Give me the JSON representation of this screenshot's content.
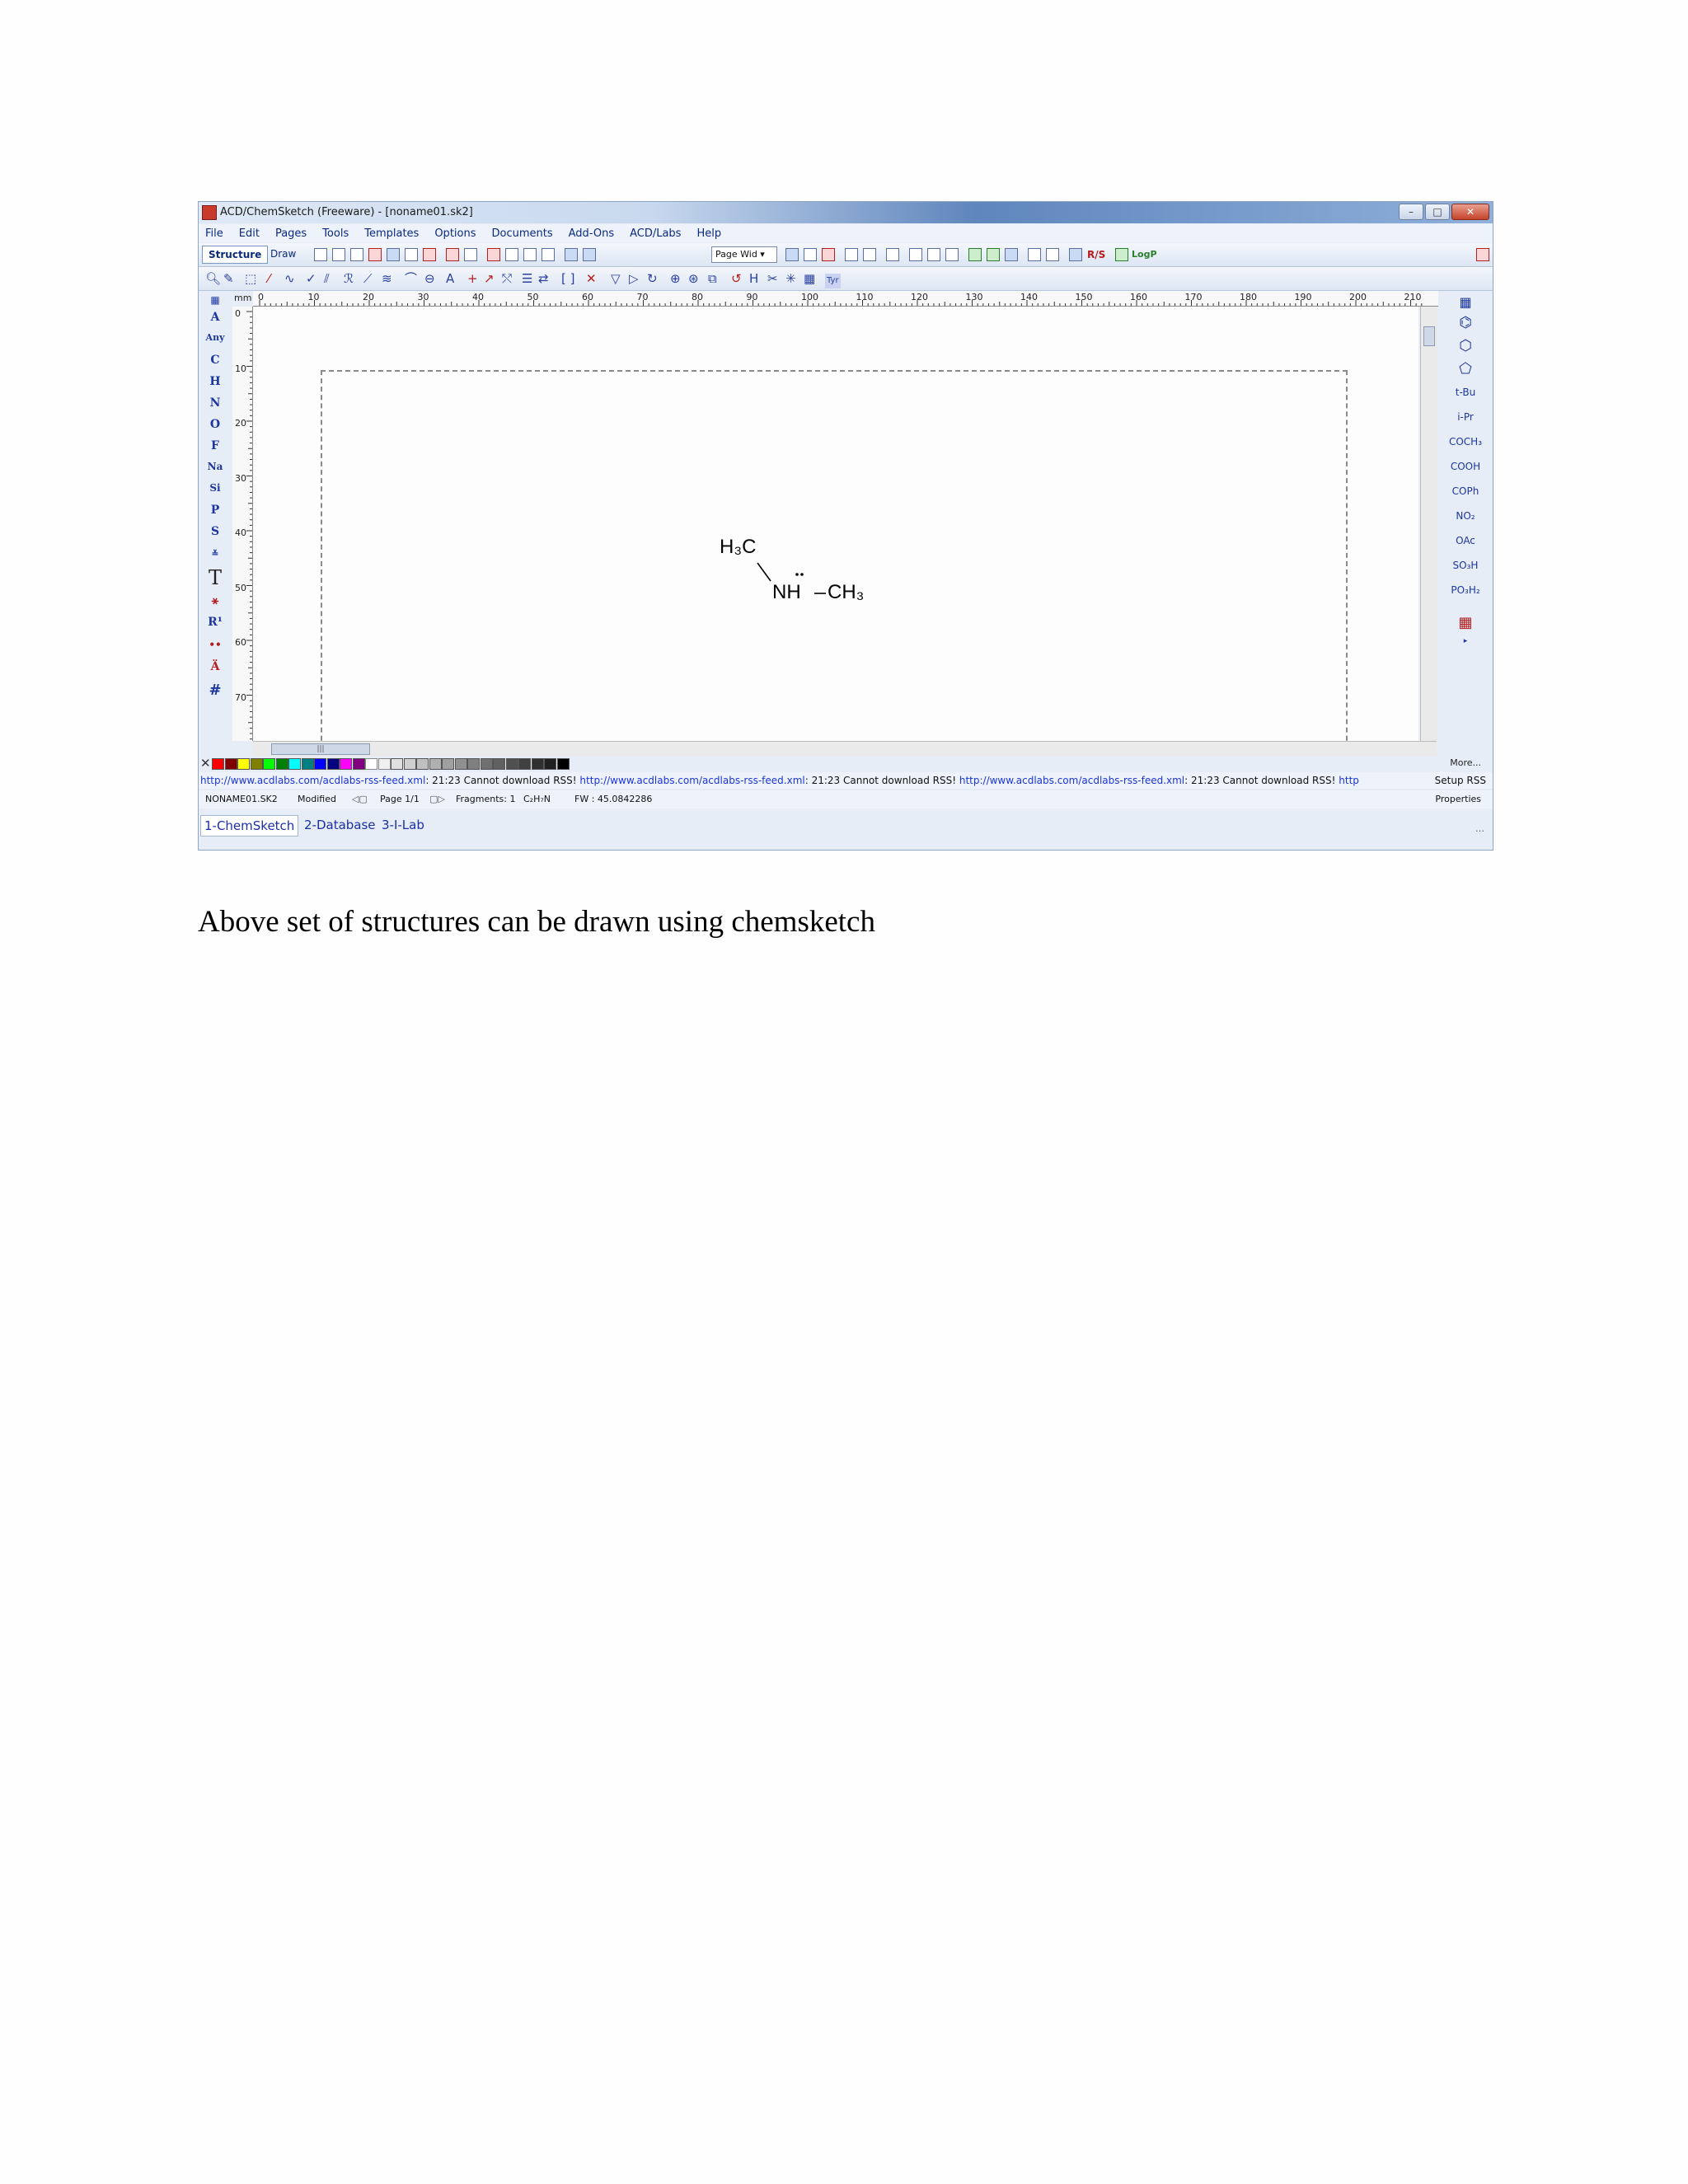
{
  "window": {
    "title": "ACD/ChemSketch (Freeware) - [noname01.sk2]"
  },
  "menu": [
    "File",
    "Edit",
    "Pages",
    "Tools",
    "Templates",
    "Options",
    "Documents",
    "Add-Ons",
    "ACD/Labs",
    "Help"
  ],
  "toolbar": {
    "structure_tab": "Structure",
    "draw_tab": "Draw",
    "zoom_value": "Page Wid",
    "rs_label": "R/S",
    "logp_label": "LogP"
  },
  "ruler": {
    "unit": "mm",
    "top_ticks": [
      "0",
      "10",
      "20",
      "30",
      "40",
      "50",
      "60",
      "70",
      "80",
      "90",
      "100",
      "110",
      "120",
      "130",
      "140",
      "150",
      "160",
      "170",
      "180",
      "190",
      "200",
      "210",
      "2"
    ],
    "left_ticks": [
      "0",
      "10",
      "20",
      "30",
      "40",
      "50",
      "60",
      "70"
    ]
  },
  "left_palette": [
    "A",
    "Any",
    "C",
    "H",
    "N",
    "O",
    "F",
    "Na",
    "Si",
    "P",
    "S",
    "T",
    "R¹",
    "#"
  ],
  "right_palette": [
    "t-Bu",
    "i-Pr",
    "COCH₃",
    "COOH",
    "COPh",
    "NO₂",
    "OAc",
    "SO₃H",
    "PO₃H₂"
  ],
  "structure": {
    "methyl_top": "H₃C",
    "amine": "NH",
    "methyl_right": "CH₃"
  },
  "rss": {
    "link": "http://www.acdlabs.com/acdlabs-rss-feed.xml",
    "message": ": 21:23 Cannot download RSS!",
    "tail": "http",
    "setup_label": "Setup RSS"
  },
  "colorbar": {
    "more_label": "More..."
  },
  "status": {
    "filename": "NONAME01.SK2",
    "modified": "Modified",
    "page": "Page 1/1",
    "fragments": "Fragments: 1",
    "formula": "C₂H₇N",
    "fw": "FW : 45.0842286",
    "properties": "Properties"
  },
  "bottom_tabs": [
    "1-ChemSketch",
    "2-Database",
    "3-I-Lab"
  ],
  "caption": "Above set of structures can be drawn using chemsketch"
}
